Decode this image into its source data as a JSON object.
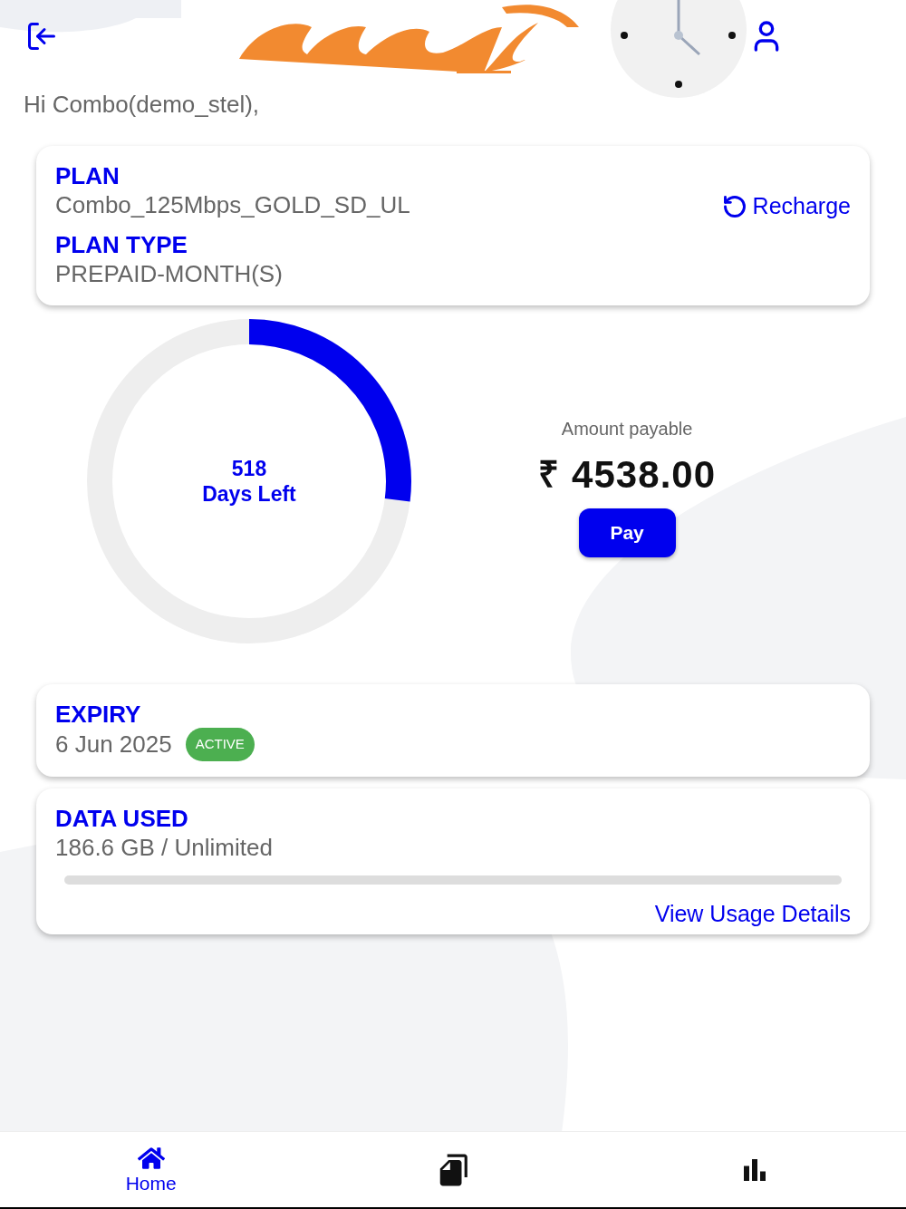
{
  "greeting": "Hi Combo(demo_stel),",
  "plan": {
    "plan_label": "PLAN",
    "plan_name": "Combo_125Mbps_GOLD_SD_UL",
    "recharge": "Recharge",
    "type_label": "PLAN TYPE",
    "type_value": "PREPAID-MONTH(S)"
  },
  "days": {
    "count": "518",
    "label": "Days Left",
    "level": 0.27
  },
  "payment": {
    "label": "Amount payable",
    "currency": "₹",
    "amount": "4538.00",
    "button": "Pay"
  },
  "expiry": {
    "label": "EXPIRY",
    "date": "6 Jun 2025",
    "status": "ACTIVE",
    "color": "#4caf50"
  },
  "data_used": {
    "label": "DATA USED",
    "value": "186.6 GB / Unlimited",
    "link": "View Usage Details"
  },
  "nav": [
    {
      "kind": "home",
      "label": "Home",
      "selected": true
    },
    {
      "kind": "documents",
      "selected": false
    },
    {
      "kind": "stats",
      "selected": false
    }
  ]
}
